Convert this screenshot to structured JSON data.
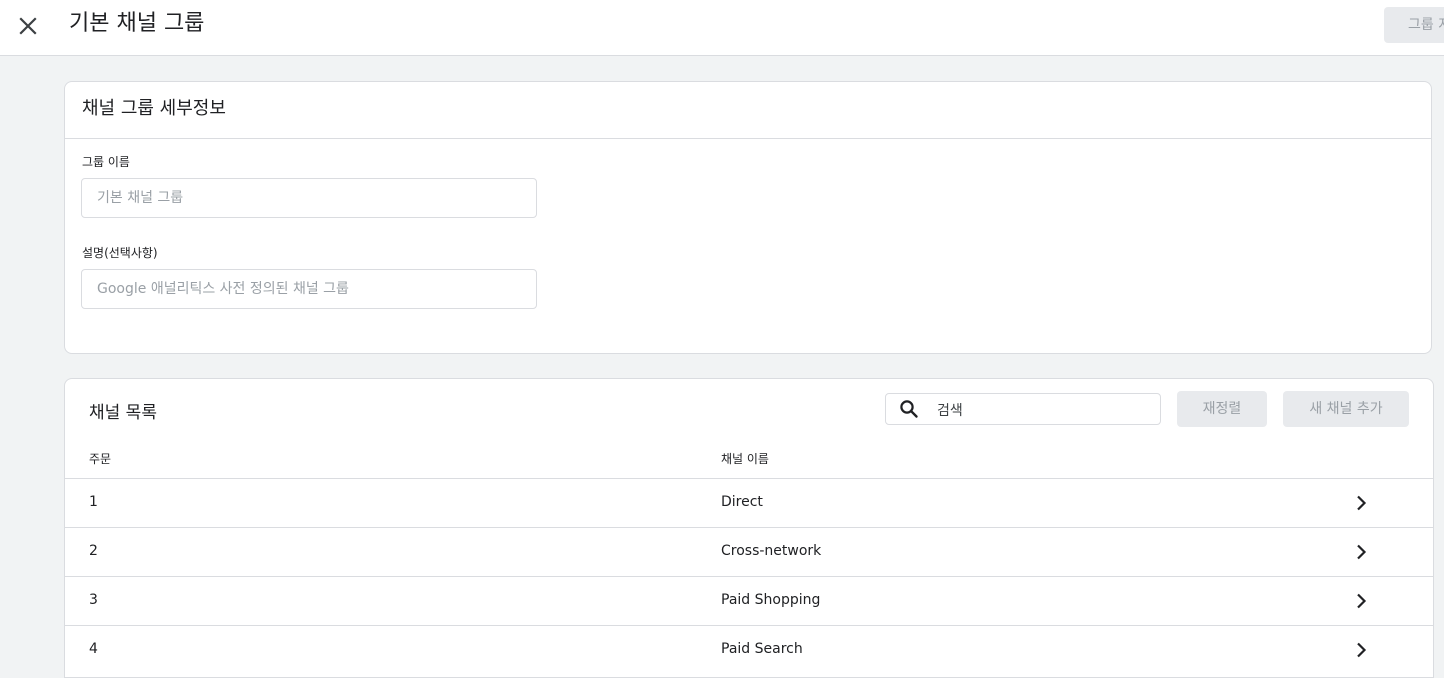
{
  "header": {
    "title": "기본 채널 그룹",
    "save_label": "그룹 저장"
  },
  "details": {
    "section_title": "채널 그룹 세부정보",
    "group_name_label": "그룹 이름",
    "group_name_placeholder": "기본 채널 그룹",
    "description_label": "설명(선택사항)",
    "description_placeholder": "Google 애널리틱스 사전 정의된 채널 그룹"
  },
  "channel_list": {
    "title": "채널 목록",
    "search_placeholder": "검색",
    "reorder_label": "재정렬",
    "add_channel_label": "새 채널 추가",
    "columns": {
      "order": "주문",
      "name": "채널 이름"
    },
    "rows": [
      {
        "order": "1",
        "name": "Direct"
      },
      {
        "order": "2",
        "name": "Cross-network"
      },
      {
        "order": "3",
        "name": "Paid Shopping"
      },
      {
        "order": "4",
        "name": "Paid Search"
      }
    ]
  },
  "icons": {
    "close": "close-icon",
    "search": "search-icon",
    "chevron": "chevron-right-icon"
  }
}
